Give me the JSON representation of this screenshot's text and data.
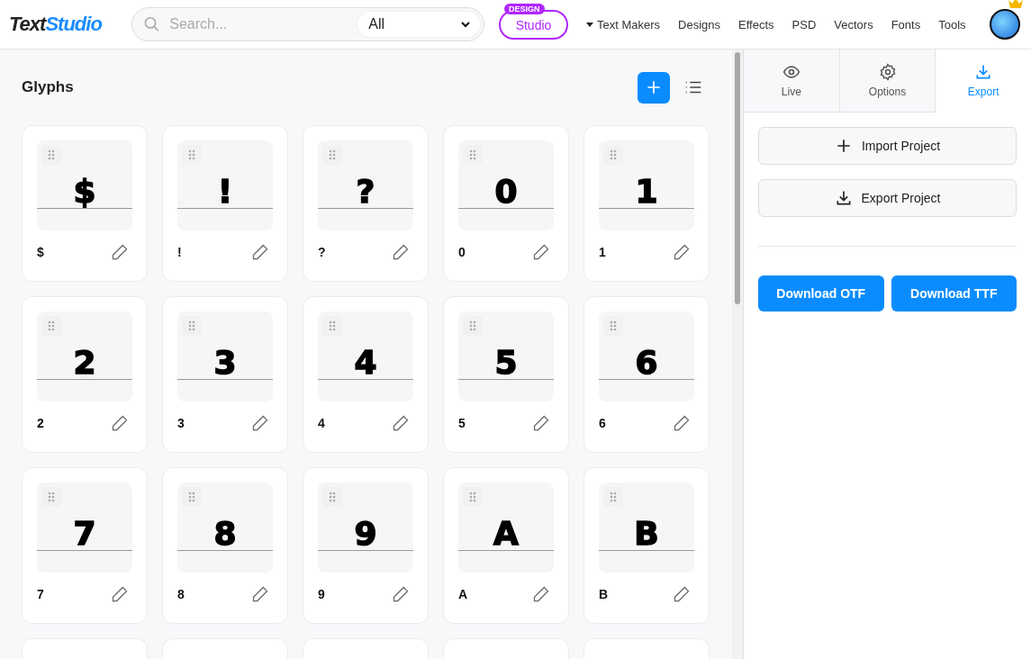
{
  "header": {
    "logo": {
      "part_1": "Text",
      "part_2": "Studio"
    },
    "search": {
      "placeholder": "Search..."
    },
    "filter": {
      "value": "All"
    },
    "studio_button": {
      "badge": "DESIGN",
      "label": "Studio"
    },
    "nav": [
      {
        "label": "Text Makers",
        "kind": "dropdown"
      },
      {
        "label": "Designs",
        "kind": "link"
      },
      {
        "label": "Effects",
        "kind": "link"
      },
      {
        "label": "PSD",
        "kind": "link"
      },
      {
        "label": "Vectors",
        "kind": "link"
      },
      {
        "label": "Fonts",
        "kind": "link"
      },
      {
        "label": "Tools",
        "kind": "link"
      }
    ]
  },
  "glyphs_panel": {
    "title": "Glyphs",
    "glyphs": [
      {
        "preview": "$",
        "label": "$"
      },
      {
        "preview": "!",
        "label": "!"
      },
      {
        "preview": "?",
        "label": "?"
      },
      {
        "preview": "0",
        "label": "0"
      },
      {
        "preview": "1",
        "label": "1"
      },
      {
        "preview": "2",
        "label": "2"
      },
      {
        "preview": "3",
        "label": "3"
      },
      {
        "preview": "4",
        "label": "4"
      },
      {
        "preview": "5",
        "label": "5"
      },
      {
        "preview": "6",
        "label": "6"
      },
      {
        "preview": "7",
        "label": "7"
      },
      {
        "preview": "8",
        "label": "8"
      },
      {
        "preview": "9",
        "label": "9"
      },
      {
        "preview": "A",
        "label": "A"
      },
      {
        "preview": "B",
        "label": "B"
      }
    ]
  },
  "side_panel": {
    "tabs": [
      {
        "label": "Live",
        "kind": "eye",
        "selected": false
      },
      {
        "label": "Options",
        "kind": "gear",
        "selected": false
      },
      {
        "label": "Export",
        "kind": "download",
        "selected": true
      }
    ],
    "project_buttons": [
      {
        "label": "Import Project",
        "kind": "plus"
      },
      {
        "label": "Export Project",
        "kind": "download"
      }
    ],
    "download_buttons": [
      "Download OTF",
      "Download TTF"
    ]
  }
}
